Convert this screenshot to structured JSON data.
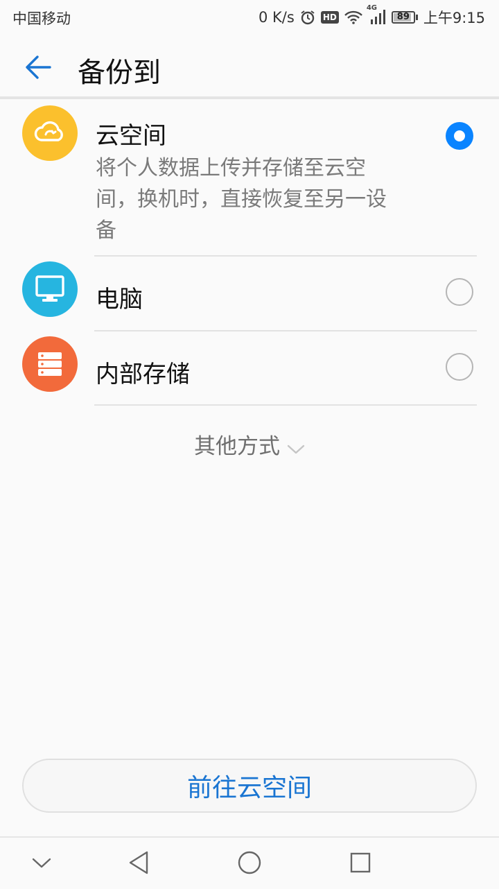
{
  "status": {
    "carrier": "中国移动",
    "speed": "0 K/s",
    "hd_badge": "HD",
    "network": "4G",
    "battery": 89,
    "time": "上午9:15"
  },
  "header": {
    "title": "备份到"
  },
  "options": [
    {
      "label": "云空间",
      "description": "将个人数据上传并存储至云空间，换机时，直接恢复至另一设备",
      "description_lines": [
        "将个人数据上传并存储至云空",
        "间，换机时，直接恢复至另一设",
        "备"
      ],
      "selected": true,
      "icon": "cloud-icon",
      "color": "#fbc02d"
    },
    {
      "label": "电脑",
      "selected": false,
      "icon": "monitor-icon",
      "color": "#26b5e0"
    },
    {
      "label": "内部存储",
      "selected": false,
      "icon": "storage-icon",
      "color": "#f26a3b"
    }
  ],
  "more": {
    "label": "其他方式"
  },
  "primary_button": {
    "label": "前往云空间"
  },
  "colors": {
    "accent": "#0a84ff",
    "button_text": "#1a75d2"
  }
}
